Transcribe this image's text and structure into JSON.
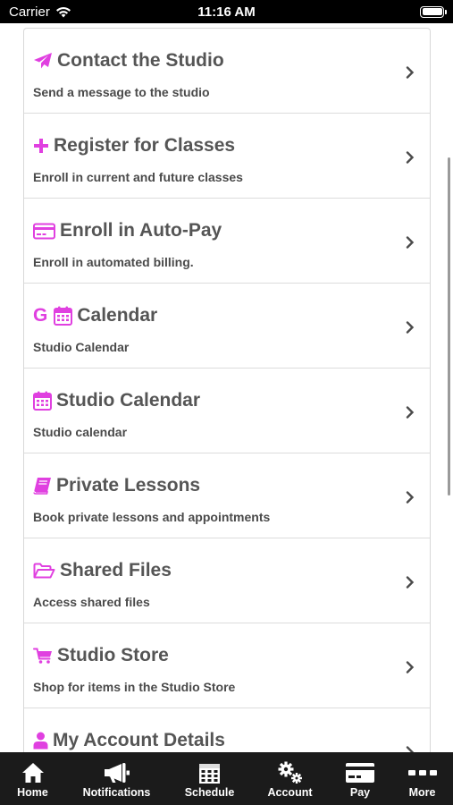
{
  "status_bar": {
    "carrier": "Carrier",
    "time": "11:16 AM"
  },
  "accent_color": "#e040e0",
  "menu": [
    {
      "title": "Contact the Studio",
      "subtitle": "Send a message to the studio",
      "icon": "paper-plane-icon"
    },
    {
      "title": "Register for Classes",
      "subtitle": "Enroll in current and future classes",
      "icon": "plus-icon"
    },
    {
      "title": "Enroll in Auto-Pay",
      "subtitle": "Enroll in automated billing.",
      "icon": "credit-card-icon"
    },
    {
      "title": "Calendar",
      "subtitle": "Studio Calendar",
      "icon": "calendar-icon",
      "prefix": "G"
    },
    {
      "title": "Studio Calendar",
      "subtitle": "Studio calendar",
      "icon": "calendar-icon"
    },
    {
      "title": "Private Lessons",
      "subtitle": "Book private lessons and appointments",
      "icon": "book-icon"
    },
    {
      "title": "Shared Files",
      "subtitle": "Access shared files",
      "icon": "folder-open-icon"
    },
    {
      "title": "Studio Store",
      "subtitle": "Shop for items in the Studio Store",
      "icon": "shopping-cart-icon"
    },
    {
      "title": "My Account Details",
      "subtitle": "",
      "icon": "user-icon"
    }
  ],
  "tabs": [
    {
      "label": "Home",
      "icon": "home-icon"
    },
    {
      "label": "Notifications",
      "icon": "megaphone-icon"
    },
    {
      "label": "Schedule",
      "icon": "calendar-grid-icon"
    },
    {
      "label": "Account",
      "icon": "gears-icon"
    },
    {
      "label": "Pay",
      "icon": "credit-card-icon"
    },
    {
      "label": "More",
      "icon": "more-dots-icon"
    }
  ]
}
